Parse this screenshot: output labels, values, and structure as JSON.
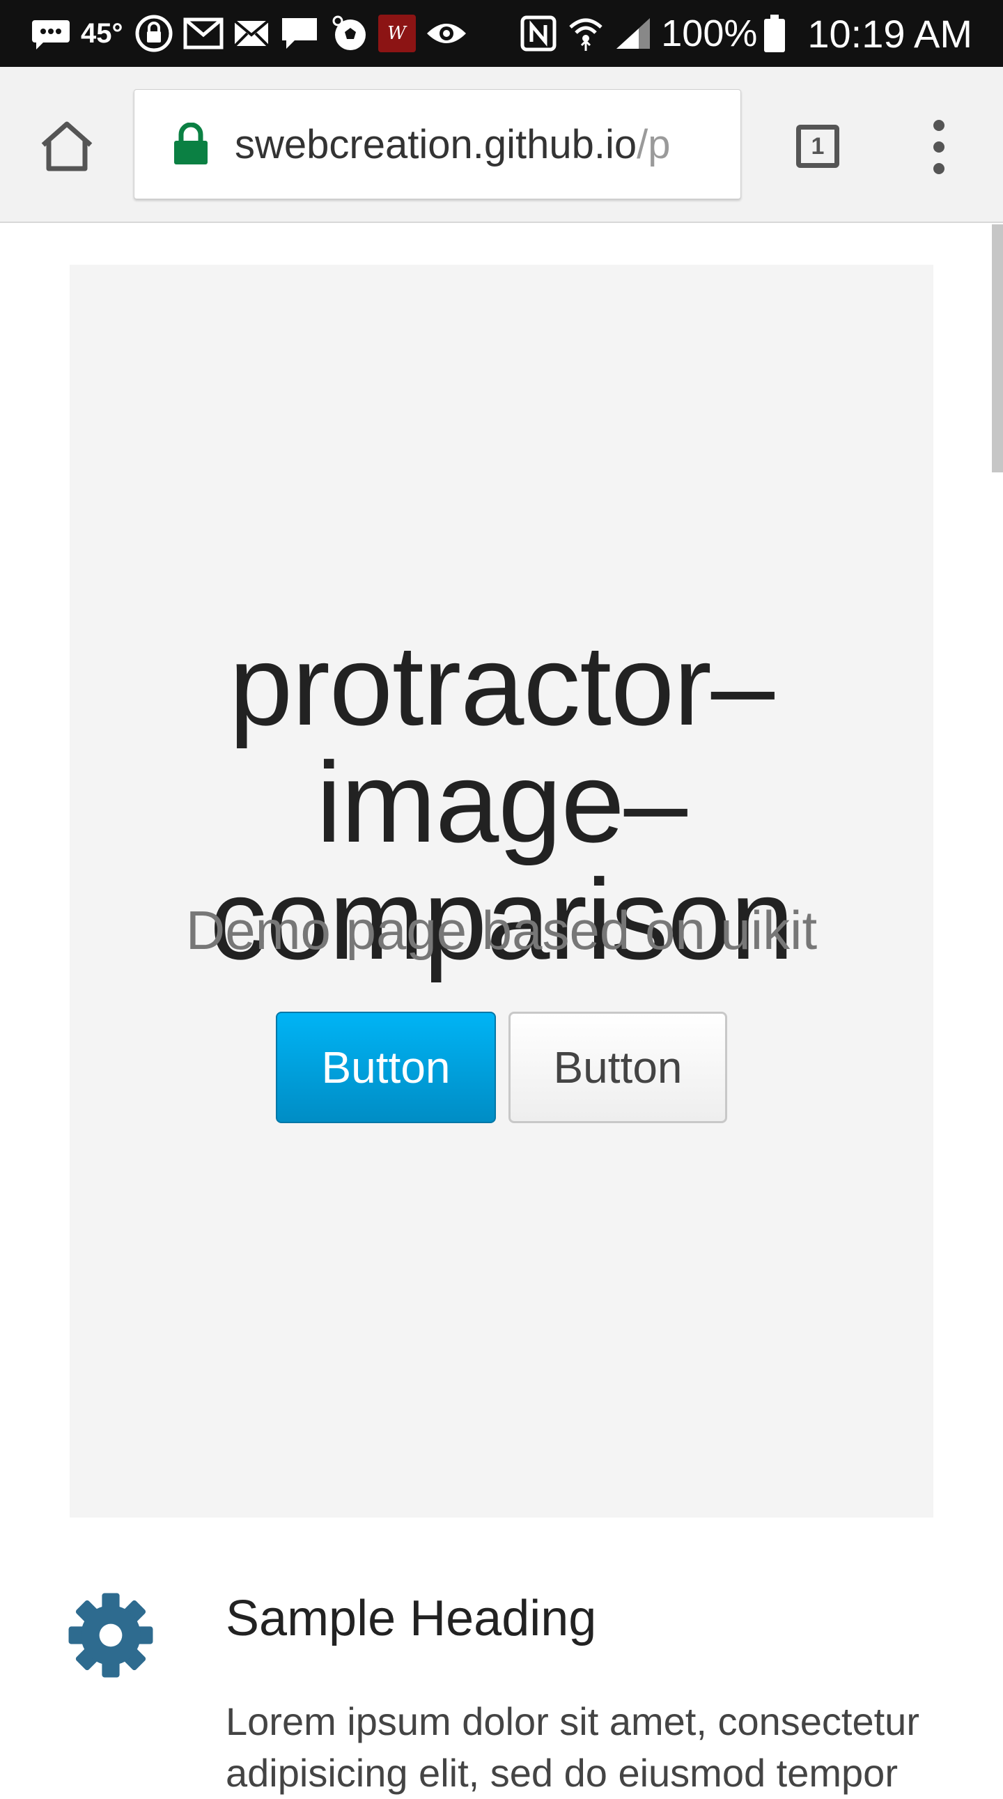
{
  "status_bar": {
    "temperature": "45°",
    "app_badge_text": "W",
    "battery": "100%",
    "time": "10:19 AM",
    "icons": [
      "message-icon",
      "lock-circle-icon",
      "gmail-icon",
      "mail-icon",
      "chat-icon",
      "soccer-icon",
      "app-badge-icon",
      "eye-icon",
      "nfc-icon",
      "wifi-icon",
      "signal-icon",
      "battery-icon"
    ]
  },
  "browser": {
    "url_host": "swebcreation.github.io",
    "url_rest": "/p",
    "tab_count": "1",
    "icons": [
      "home-icon",
      "lock-icon",
      "tabs-icon",
      "more-vert-icon"
    ]
  },
  "hero": {
    "title": "protractor–image–comparison",
    "subtitle": "Demo page based on uikit",
    "primary_button": "Button",
    "default_button": "Button"
  },
  "feature": {
    "heading": "Sample Heading",
    "body": "Lorem ipsum dolor sit amet, consectetur adipisicing elit, sed do eiusmod tempor"
  },
  "colors": {
    "status_bar_bg": "#111111",
    "toolbar_bg": "#f2f2f2",
    "lock_green": "#0b8043",
    "hero_bg": "#f4f4f4",
    "primary_button": "#00a8e6",
    "gear_icon": "#2e6b8f"
  }
}
